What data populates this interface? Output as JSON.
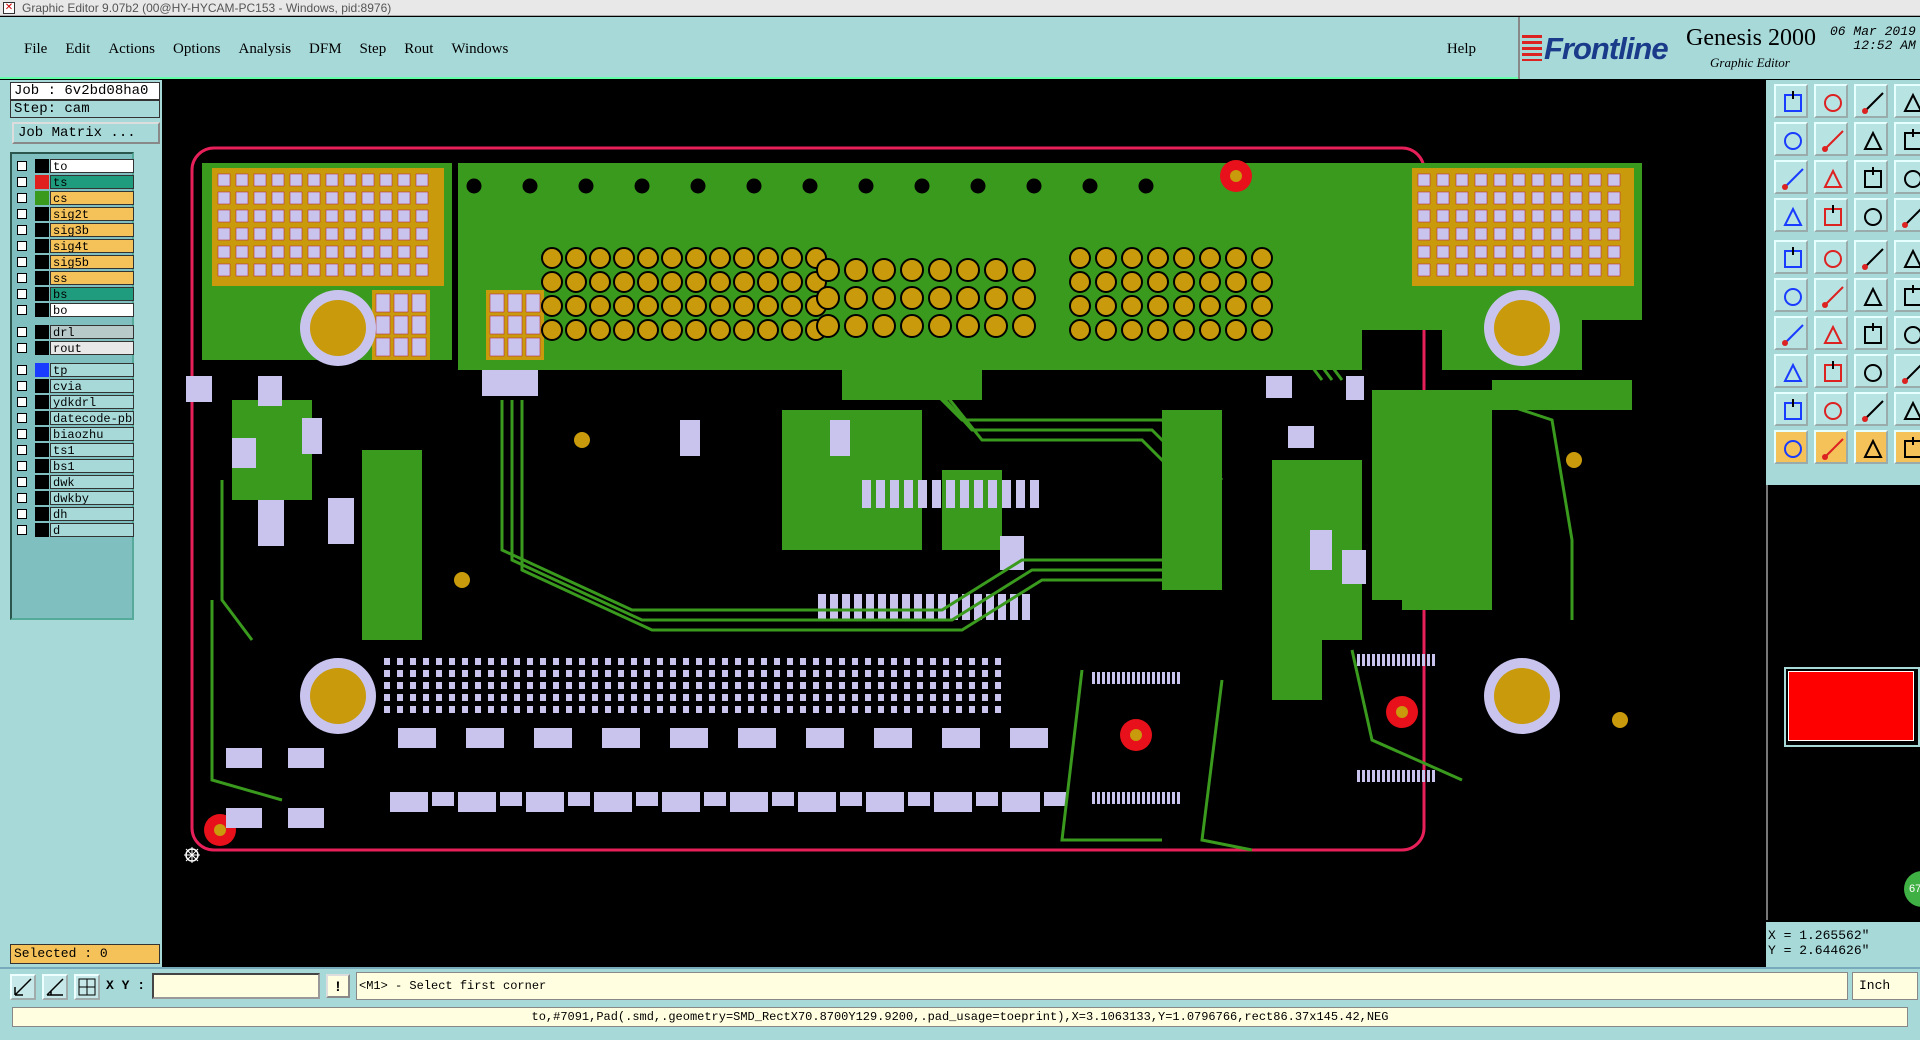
{
  "window": {
    "title": "Graphic Editor 9.07b2 (00@HY-HYCAM-PC153 - Windows, pid:8976)"
  },
  "menu": {
    "items": [
      {
        "label": "File"
      },
      {
        "label": "Edit"
      },
      {
        "label": "Actions"
      },
      {
        "label": "Options"
      },
      {
        "label": "Analysis"
      },
      {
        "label": "DFM"
      },
      {
        "label": "Step"
      },
      {
        "label": "Rout"
      },
      {
        "label": "Windows"
      }
    ],
    "help": "Help"
  },
  "logo": {
    "brand": "Frontline",
    "product": "Genesis 2000",
    "subtitle": "Graphic Editor",
    "date": "06 Mar 2019",
    "time": "12:52 AM"
  },
  "job": {
    "job": "Job : 6v2bd08ha0",
    "step": "Step: cam",
    "matrix_button": "Job Matrix ..."
  },
  "layers": {
    "board": [
      {
        "name": "to",
        "color": "#ffffff",
        "swatch": "#000000"
      },
      {
        "name": "ts",
        "color": "#1f9b7d",
        "swatch": "#e0201c"
      },
      {
        "name": "cs",
        "color": "#f5c25a",
        "swatch": "#3a9a1e"
      },
      {
        "name": "sig2t",
        "color": "#f5c25a",
        "swatch": "#000000"
      },
      {
        "name": "sig3b",
        "color": "#f5c25a",
        "swatch": "#000000"
      },
      {
        "name": "sig4t",
        "color": "#f5c25a",
        "swatch": "#000000"
      },
      {
        "name": "sig5b",
        "color": "#f5c25a",
        "swatch": "#000000"
      },
      {
        "name": "ss",
        "color": "#f5c25a",
        "swatch": "#000000"
      },
      {
        "name": "bs",
        "color": "#1f9b7d",
        "swatch": "#000000"
      },
      {
        "name": "bo",
        "color": "#ffffff",
        "swatch": "#000000"
      }
    ],
    "drill": [
      {
        "name": "drl",
        "color": "#b7c9c9",
        "swatch": "#000000"
      },
      {
        "name": "rout",
        "color": "#e8e8e8",
        "swatch": "#000000"
      }
    ],
    "misc": [
      {
        "name": "tp",
        "color": "#a7d9d9",
        "swatch": "#1a3cff"
      },
      {
        "name": "cvia",
        "color": "#a7d9d9",
        "swatch": "#000000"
      },
      {
        "name": "ydkdrl",
        "color": "#a7d9d9",
        "swatch": "#000000"
      },
      {
        "name": "datecode-pb",
        "color": "#a7d9d9",
        "swatch": "#000000"
      },
      {
        "name": "biaozhu",
        "color": "#a7d9d9",
        "swatch": "#000000"
      },
      {
        "name": "ts1",
        "color": "#a7d9d9",
        "swatch": "#000000"
      },
      {
        "name": "bs1",
        "color": "#a7d9d9",
        "swatch": "#000000"
      },
      {
        "name": "dwk",
        "color": "#a7d9d9",
        "swatch": "#000000"
      },
      {
        "name": "dwkby",
        "color": "#a7d9d9",
        "swatch": "#000000"
      },
      {
        "name": "dh",
        "color": "#a7d9d9",
        "swatch": "#000000"
      },
      {
        "name": "d",
        "color": "#a7d9d9",
        "swatch": "#000000"
      }
    ]
  },
  "selected": "Selected : 0",
  "coords": {
    "x": "X = 1.265562\"",
    "y": "Y = 2.644626\""
  },
  "zoom_badge": "67",
  "command": {
    "xy_label": "X Y :",
    "xy_value": "",
    "bang": "!",
    "prompt": "<M1> - Select first corner",
    "units": "Inch"
  },
  "status": "to,#7091,Pad(.smd,.geometry=SMD_RectX70.8700Y129.9200,.pad_usage=toeprint),X=3.1063133,Y=1.0796766,rect86.37x145.42,NEG",
  "colors": {
    "panel": "#a7d9d9",
    "copper": "#3a9a1e",
    "pad": "#c8c4ee",
    "gold": "#c89a0c",
    "outline": "#e8205a",
    "highlight": "#f5c25a"
  }
}
